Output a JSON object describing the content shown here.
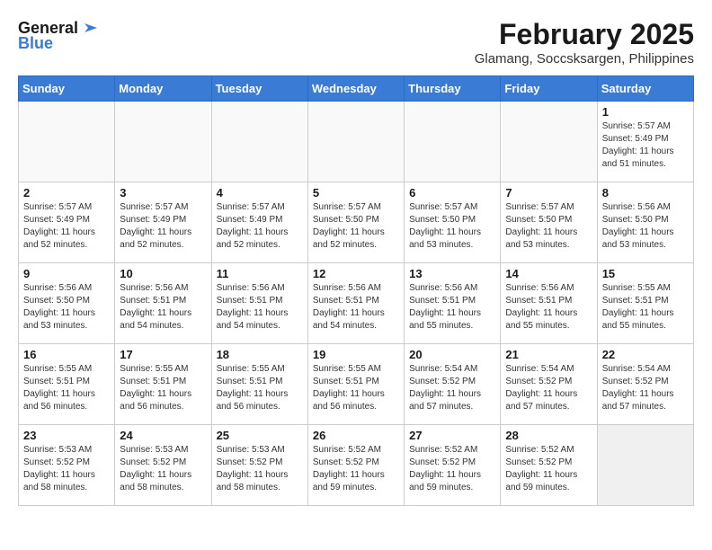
{
  "header": {
    "logo_line1": "General",
    "logo_line2": "Blue",
    "month_title": "February 2025",
    "location": "Glamang, Soccsksargen, Philippines"
  },
  "weekdays": [
    "Sunday",
    "Monday",
    "Tuesday",
    "Wednesday",
    "Thursday",
    "Friday",
    "Saturday"
  ],
  "weeks": [
    [
      {
        "day": "",
        "info": ""
      },
      {
        "day": "",
        "info": ""
      },
      {
        "day": "",
        "info": ""
      },
      {
        "day": "",
        "info": ""
      },
      {
        "day": "",
        "info": ""
      },
      {
        "day": "",
        "info": ""
      },
      {
        "day": "1",
        "info": "Sunrise: 5:57 AM\nSunset: 5:49 PM\nDaylight: 11 hours\nand 51 minutes."
      }
    ],
    [
      {
        "day": "2",
        "info": "Sunrise: 5:57 AM\nSunset: 5:49 PM\nDaylight: 11 hours\nand 52 minutes."
      },
      {
        "day": "3",
        "info": "Sunrise: 5:57 AM\nSunset: 5:49 PM\nDaylight: 11 hours\nand 52 minutes."
      },
      {
        "day": "4",
        "info": "Sunrise: 5:57 AM\nSunset: 5:49 PM\nDaylight: 11 hours\nand 52 minutes."
      },
      {
        "day": "5",
        "info": "Sunrise: 5:57 AM\nSunset: 5:50 PM\nDaylight: 11 hours\nand 52 minutes."
      },
      {
        "day": "6",
        "info": "Sunrise: 5:57 AM\nSunset: 5:50 PM\nDaylight: 11 hours\nand 53 minutes."
      },
      {
        "day": "7",
        "info": "Sunrise: 5:57 AM\nSunset: 5:50 PM\nDaylight: 11 hours\nand 53 minutes."
      },
      {
        "day": "8",
        "info": "Sunrise: 5:56 AM\nSunset: 5:50 PM\nDaylight: 11 hours\nand 53 minutes."
      }
    ],
    [
      {
        "day": "9",
        "info": "Sunrise: 5:56 AM\nSunset: 5:50 PM\nDaylight: 11 hours\nand 53 minutes."
      },
      {
        "day": "10",
        "info": "Sunrise: 5:56 AM\nSunset: 5:51 PM\nDaylight: 11 hours\nand 54 minutes."
      },
      {
        "day": "11",
        "info": "Sunrise: 5:56 AM\nSunset: 5:51 PM\nDaylight: 11 hours\nand 54 minutes."
      },
      {
        "day": "12",
        "info": "Sunrise: 5:56 AM\nSunset: 5:51 PM\nDaylight: 11 hours\nand 54 minutes."
      },
      {
        "day": "13",
        "info": "Sunrise: 5:56 AM\nSunset: 5:51 PM\nDaylight: 11 hours\nand 55 minutes."
      },
      {
        "day": "14",
        "info": "Sunrise: 5:56 AM\nSunset: 5:51 PM\nDaylight: 11 hours\nand 55 minutes."
      },
      {
        "day": "15",
        "info": "Sunrise: 5:55 AM\nSunset: 5:51 PM\nDaylight: 11 hours\nand 55 minutes."
      }
    ],
    [
      {
        "day": "16",
        "info": "Sunrise: 5:55 AM\nSunset: 5:51 PM\nDaylight: 11 hours\nand 56 minutes."
      },
      {
        "day": "17",
        "info": "Sunrise: 5:55 AM\nSunset: 5:51 PM\nDaylight: 11 hours\nand 56 minutes."
      },
      {
        "day": "18",
        "info": "Sunrise: 5:55 AM\nSunset: 5:51 PM\nDaylight: 11 hours\nand 56 minutes."
      },
      {
        "day": "19",
        "info": "Sunrise: 5:55 AM\nSunset: 5:51 PM\nDaylight: 11 hours\nand 56 minutes."
      },
      {
        "day": "20",
        "info": "Sunrise: 5:54 AM\nSunset: 5:52 PM\nDaylight: 11 hours\nand 57 minutes."
      },
      {
        "day": "21",
        "info": "Sunrise: 5:54 AM\nSunset: 5:52 PM\nDaylight: 11 hours\nand 57 minutes."
      },
      {
        "day": "22",
        "info": "Sunrise: 5:54 AM\nSunset: 5:52 PM\nDaylight: 11 hours\nand 57 minutes."
      }
    ],
    [
      {
        "day": "23",
        "info": "Sunrise: 5:53 AM\nSunset: 5:52 PM\nDaylight: 11 hours\nand 58 minutes."
      },
      {
        "day": "24",
        "info": "Sunrise: 5:53 AM\nSunset: 5:52 PM\nDaylight: 11 hours\nand 58 minutes."
      },
      {
        "day": "25",
        "info": "Sunrise: 5:53 AM\nSunset: 5:52 PM\nDaylight: 11 hours\nand 58 minutes."
      },
      {
        "day": "26",
        "info": "Sunrise: 5:52 AM\nSunset: 5:52 PM\nDaylight: 11 hours\nand 59 minutes."
      },
      {
        "day": "27",
        "info": "Sunrise: 5:52 AM\nSunset: 5:52 PM\nDaylight: 11 hours\nand 59 minutes."
      },
      {
        "day": "28",
        "info": "Sunrise: 5:52 AM\nSunset: 5:52 PM\nDaylight: 11 hours\nand 59 minutes."
      },
      {
        "day": "",
        "info": ""
      }
    ]
  ]
}
